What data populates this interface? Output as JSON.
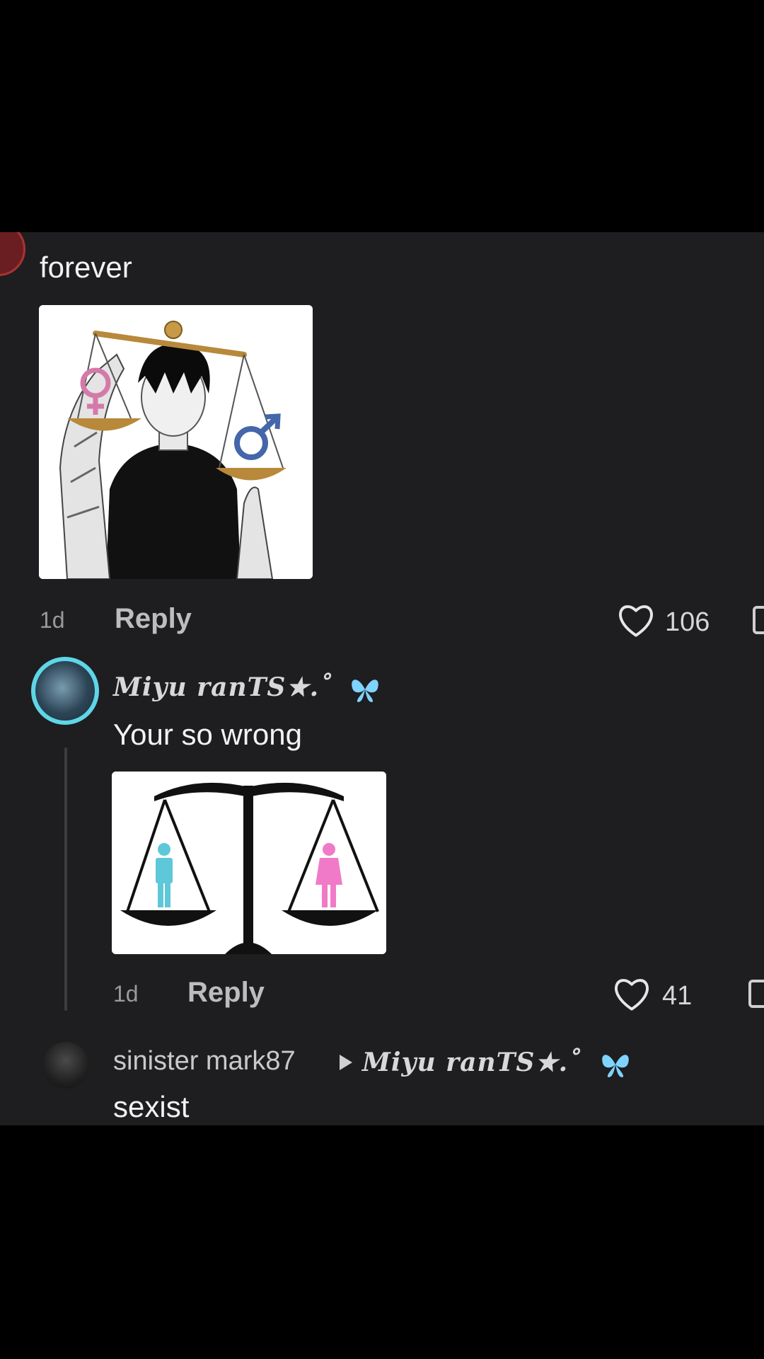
{
  "comments": [
    {
      "text": "forever",
      "time": "1d",
      "reply_label": "Reply",
      "likes": "106",
      "image_icon": "scales-of-justice-character-image"
    },
    {
      "username": "Miyu ranTS★.˚",
      "text": "Your so wrong",
      "time": "1d",
      "reply_label": "Reply",
      "likes": "41",
      "image_icon": "balance-scale-gender-icons-image"
    },
    {
      "username": "sinister mark87",
      "reply_to": "Miyu ranTS★.˚",
      "text": "sexist"
    }
  ],
  "colors": {
    "panel_bg": "#1e1d20",
    "frame_bg": "#000000",
    "butterfly": "#7fd3ff",
    "male_figure": "#5ec8d8",
    "female_figure": "#f07ac8"
  }
}
